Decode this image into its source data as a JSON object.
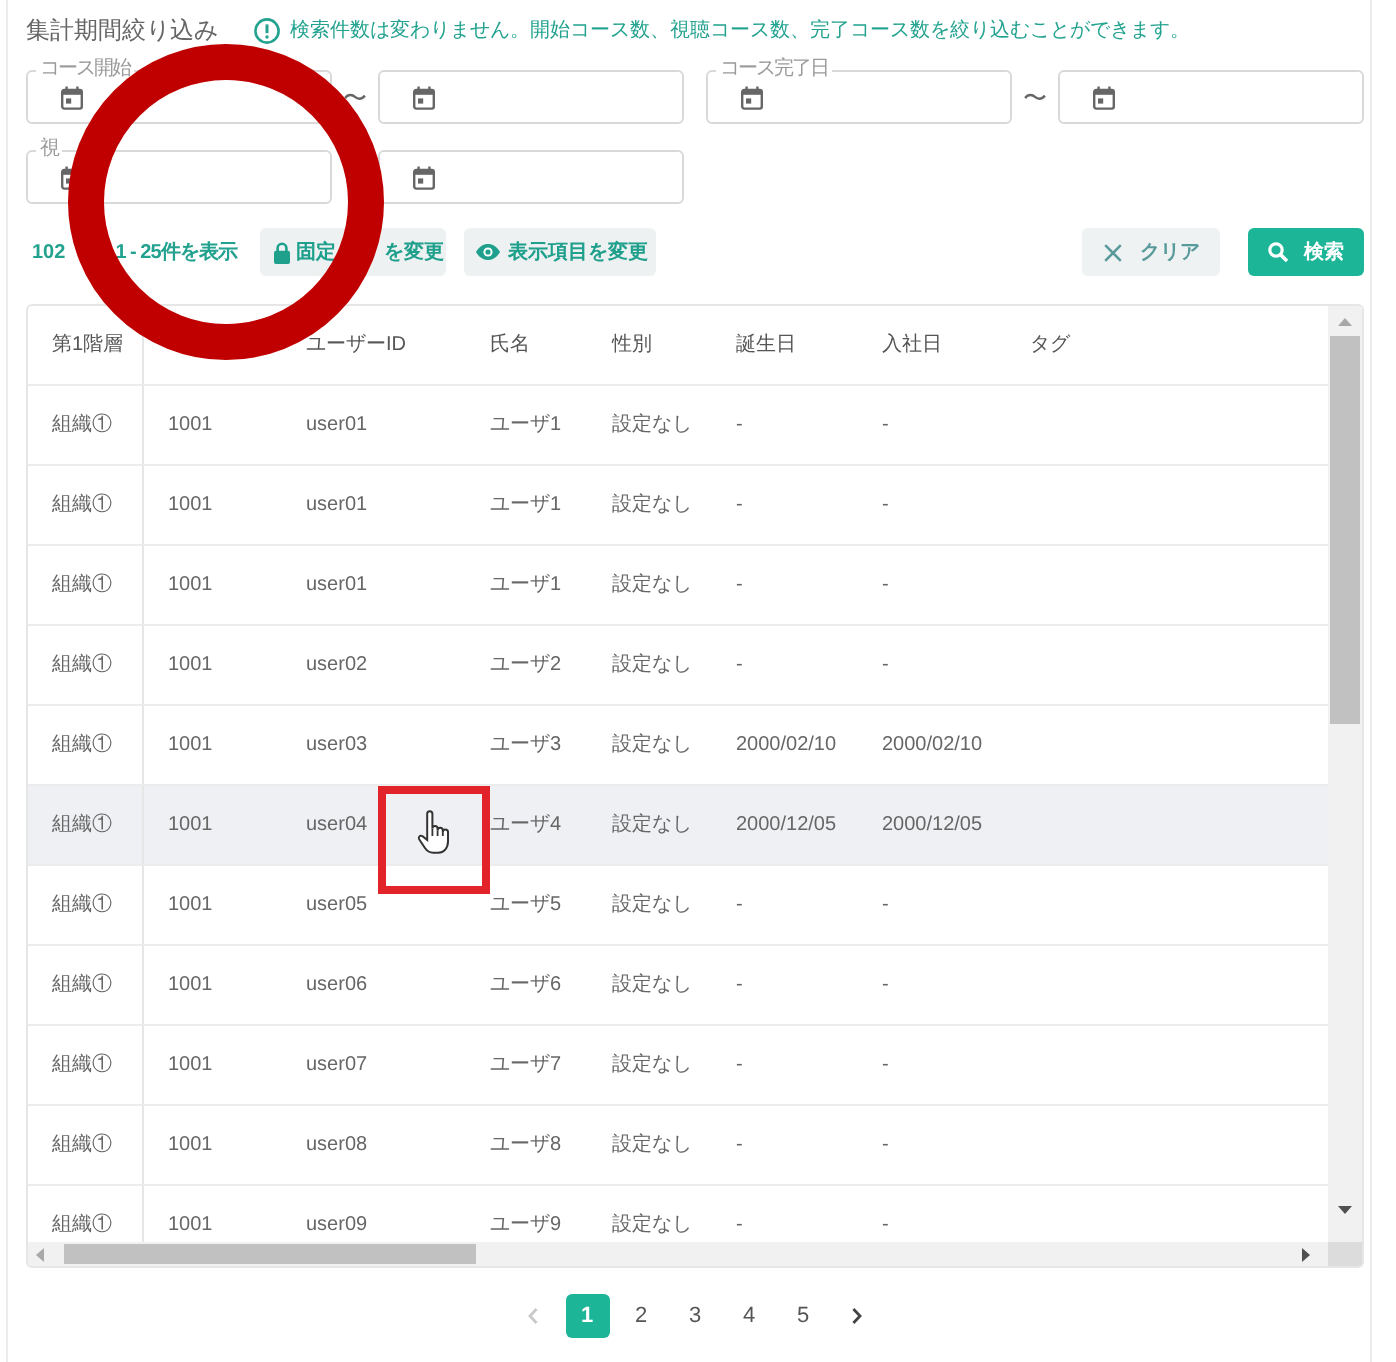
{
  "filter_title": "集計期間絞り込み",
  "notice": "検索件数は変わりません。開始コース数、視聴コース数、完了コース数を絞り込むことができます。",
  "date_filters": [
    {
      "label": "コース開始",
      "separator": "〜"
    },
    {
      "label": "コース完了日",
      "separator": "〜"
    },
    {
      "label": "視"
    }
  ],
  "toolbar": {
    "count_parts": [
      "102",
      "1 - 25件を表示"
    ],
    "buttons": [
      {
        "text_parts": [
          "固定",
          "を変更"
        ]
      },
      {
        "text_parts": [
          "表示項目を変更"
        ]
      }
    ],
    "actions": [
      {
        "kind": "secondary",
        "label": "クリア"
      },
      {
        "kind": "primary",
        "label": "検索"
      }
    ]
  },
  "table": {
    "columns": {
      "level_1": "第1階層",
      "user_id": "ユーザーID",
      "name": "氏名",
      "gender": "性別",
      "birth_date": "誕生日",
      "hire_date": "入社日",
      "tag": "タグ"
    },
    "rows": [
      {
        "hovered": false,
        "level_1": "組織①",
        "column_2": "1001",
        "user_id": "user01",
        "name": "ユーザ1",
        "gender": "設定なし",
        "birth_date": "-",
        "hire_date": "-"
      },
      {
        "hovered": false,
        "level_1": "組織①",
        "column_2": "1001",
        "user_id": "user01",
        "name": "ユーザ1",
        "gender": "設定なし",
        "birth_date": "-",
        "hire_date": "-"
      },
      {
        "hovered": false,
        "level_1": "組織①",
        "column_2": "1001",
        "user_id": "user01",
        "name": "ユーザ1",
        "gender": "設定なし",
        "birth_date": "-",
        "hire_date": "-"
      },
      {
        "hovered": false,
        "level_1": "組織①",
        "column_2": "1001",
        "user_id": "user02",
        "name": "ユーザ2",
        "gender": "設定なし",
        "birth_date": "-",
        "hire_date": "-"
      },
      {
        "hovered": false,
        "level_1": "組織①",
        "column_2": "1001",
        "user_id": "user03",
        "name": "ユーザ3",
        "gender": "設定なし",
        "birth_date": "2000/02/10",
        "hire_date": "2000/02/10"
      },
      {
        "hovered": true,
        "level_1": "組織①",
        "column_2": "1001",
        "user_id": "user04",
        "name": "ユーザ4",
        "gender": "設定なし",
        "birth_date": "2000/12/05",
        "hire_date": "2000/12/05"
      },
      {
        "hovered": false,
        "level_1": "組織①",
        "column_2": "1001",
        "user_id": "user05",
        "name": "ユーザ5",
        "gender": "設定なし",
        "birth_date": "-",
        "hire_date": "-"
      },
      {
        "hovered": false,
        "level_1": "組織①",
        "column_2": "1001",
        "user_id": "user06",
        "name": "ユーザ6",
        "gender": "設定なし",
        "birth_date": "-",
        "hire_date": "-"
      },
      {
        "hovered": false,
        "level_1": "組織①",
        "column_2": "1001",
        "user_id": "user07",
        "name": "ユーザ7",
        "gender": "設定なし",
        "birth_date": "-",
        "hire_date": "-"
      },
      {
        "hovered": false,
        "level_1": "組織①",
        "column_2": "1001",
        "user_id": "user08",
        "name": "ユーザ8",
        "gender": "設定なし",
        "birth_date": "-",
        "hire_date": "-"
      },
      {
        "hovered": false,
        "level_1": "組織①",
        "column_2": "1001",
        "user_id": "user09",
        "name": "ユーザ9",
        "gender": "設定なし",
        "birth_date": "-",
        "hire_date": "-"
      }
    ]
  },
  "pagination": {
    "prev_disabled": true,
    "next_disabled": false,
    "pages": [
      {
        "label": "1",
        "selected": true
      },
      {
        "label": "2",
        "selected": false
      },
      {
        "label": "3",
        "selected": false
      },
      {
        "label": "4",
        "selected": false
      },
      {
        "label": "5",
        "selected": false
      }
    ]
  },
  "annotations": [
    {
      "kind": "ring"
    },
    {
      "kind": "frame"
    },
    {
      "kind": "pointer"
    }
  ]
}
